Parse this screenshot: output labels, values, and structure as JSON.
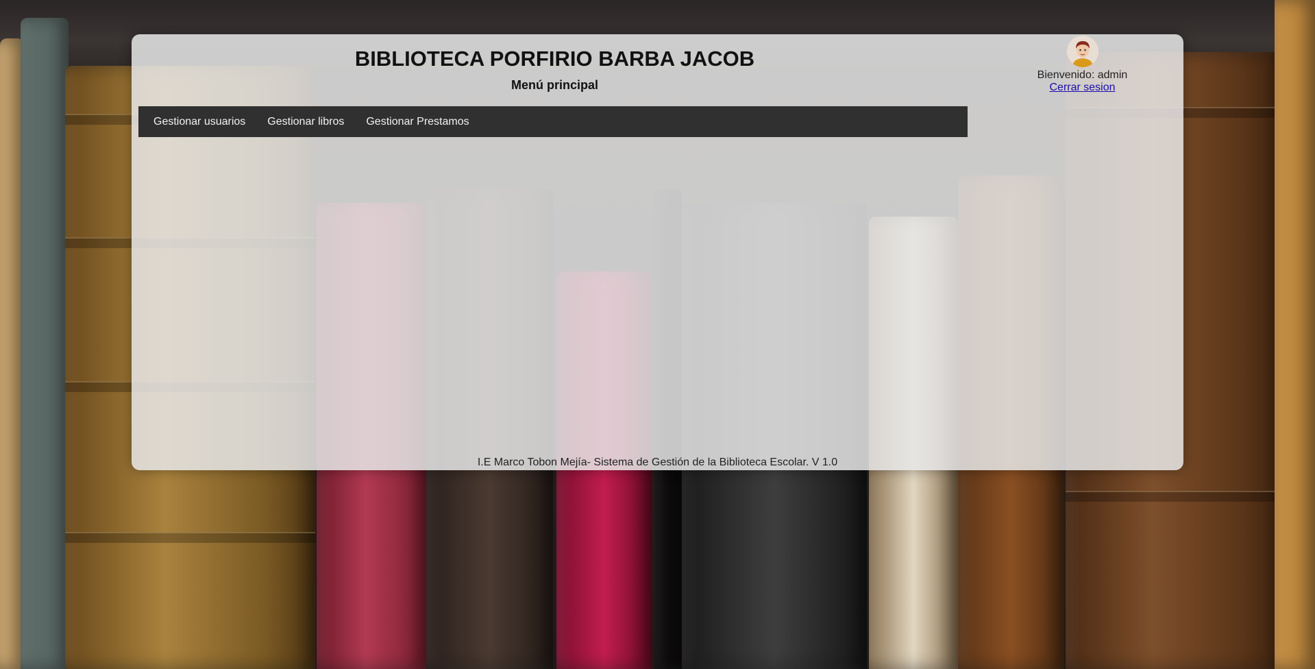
{
  "header": {
    "title": "BIBLIOTECA PORFIRIO BARBA JACOB",
    "subtitle": "Menú principal"
  },
  "nav": {
    "items": [
      {
        "label": "Gestionar usuarios"
      },
      {
        "label": "Gestionar libros"
      },
      {
        "label": "Gestionar Prestamos"
      }
    ]
  },
  "user": {
    "welcome": "Bienvenido: admin",
    "logout_label": "Cerrar sesion",
    "avatar_icon": "user-avatar-icon"
  },
  "footer": {
    "text": "I.E Marco Tobon Mejía- Sistema de Gestión de la Biblioteca Escolar. V 1.0"
  },
  "colors": {
    "navbar": "#303030",
    "panel": "#e6e6e6",
    "link": "#1a0dab"
  }
}
